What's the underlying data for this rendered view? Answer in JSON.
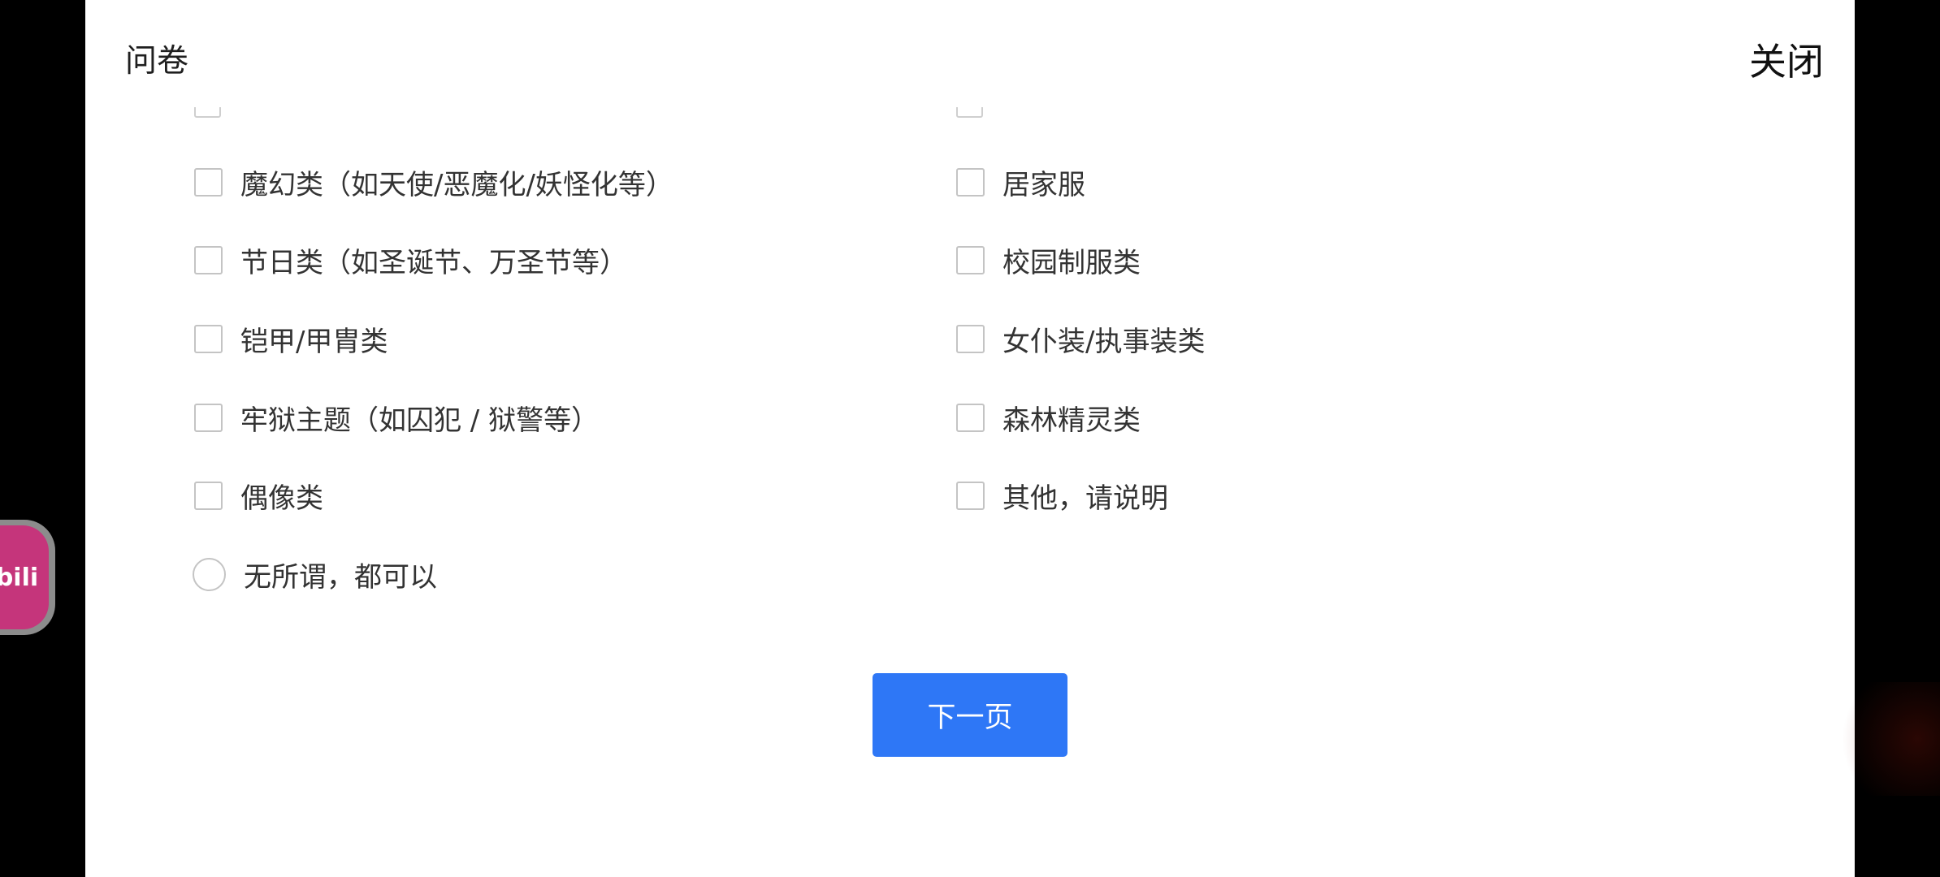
{
  "header": {
    "title": "问卷",
    "close_label": "关闭"
  },
  "options_left": [
    {
      "label": "魔幻类（如天使/恶魔化/妖怪化等）",
      "type": "checkbox"
    },
    {
      "label": "节日类（如圣诞节、万圣节等）",
      "type": "checkbox"
    },
    {
      "label": "铠甲/甲胄类",
      "type": "checkbox"
    },
    {
      "label": "牢狱主题（如囚犯 / 狱警等）",
      "type": "checkbox"
    },
    {
      "label": "偶像类",
      "type": "checkbox"
    },
    {
      "label": "无所谓，都可以",
      "type": "radio"
    }
  ],
  "options_right": [
    {
      "label": "居家服",
      "type": "checkbox"
    },
    {
      "label": "校园制服类",
      "type": "checkbox"
    },
    {
      "label": "女仆装/执事装类",
      "type": "checkbox"
    },
    {
      "label": "森林精灵类",
      "type": "checkbox"
    },
    {
      "label": "其他，请说明",
      "type": "checkbox"
    }
  ],
  "footer": {
    "next_label": "下一页"
  },
  "floating": {
    "logo_text": "bili"
  },
  "colors": {
    "primary": "#2e77f6",
    "logo": "#c5357b"
  }
}
